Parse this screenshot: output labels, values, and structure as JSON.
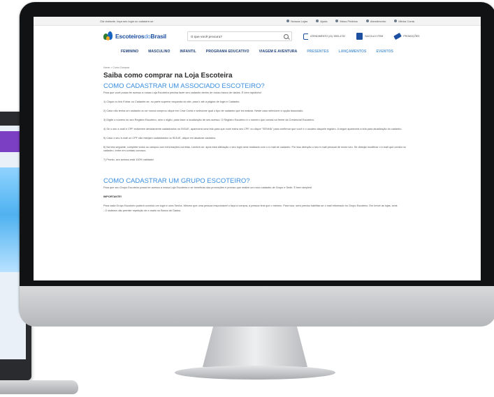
{
  "site": {
    "topbar": {
      "greeting": "Olá visitante, faça seu login ou cadastre-se",
      "links": [
        "Nossas Lojas",
        "Ajuda",
        "Meus Pedidos",
        "Atendimento",
        "Minha Conta"
      ]
    },
    "logo": {
      "part1": "Escoteiros",
      "part2": "do",
      "part3": "Brasil"
    },
    "search": {
      "placeholder": "O que você procura?"
    },
    "header_items": {
      "phone": "ATENDIMENTO (41) 3353-4732",
      "bag": "SACOLA 0 ITEM",
      "promo": "PROMOÇÕES"
    },
    "nav": [
      "FEMININO",
      "MASCULINO",
      "INFANTIL",
      "PROGRAMA EDUCATIVO",
      "VIAGEM E AVENTURA",
      "PRESENTES",
      "LANÇAMENTOS",
      "EVENTOS"
    ],
    "breadcrumb": "Home > Como Comprar",
    "title": "Saiba como comprar na Loja Escoteira",
    "section1": {
      "heading": "COMO CADASTRAR UM ASSOCIADO ESCOTEIRO?",
      "intro": "Para que você possa ter acesso a nossa Loja Escoteira precisa fazer seu cadastro dentro de nosso banco de dados. É bem rapidinho!",
      "steps": [
        "1) Clique no link Entrar ou Cadastre-se, no parte superior esquerda do site, para ir até a página de login e Cadastro.",
        "2) Caso não tenha um cadastro ou se nunca comprou clique em Criar Conta e selecione qual o tipo de cadastro que irá realizar. Neste caso selecione a opção Associado.",
        "3) Digite o número do seu Registro Escoteiro, sem o dígito, para fazer a localização de seu acesso. O Registro Escoteiro é o número que consta na frente da Credencial Escoteira.",
        "4) Se o seu e-mail e CPF estiverem devidamente cadastrados no SIGUE, aparecerá uma tela para que você insira seu CPF, ou clique \"SENHA\" para confirmar que você é o usuário daquele registro. A seguir aparecerá a tela para atualização do cadastro.",
        "5) Caso o seu e-mail ou CPF não estejam cadastrados no SIGUE, clique em atualizar cadastro.",
        "6) Na tela seguinte, complete todos os campos com informações corretas. Lembre-se, após esta alteração o seu login será realizado com o e-mail de cadastro. Por isso atenção o seu e-mail pessoal de modo seu. Se desejar modificar o e-mail que consta no cadastro, entre em contato conosco.",
        "7) Pronto, seu acesso está 100% validado!"
      ]
    },
    "section2": {
      "heading": "COMO CADASTRAR UM GRUPO ESCOTEIRO?",
      "intro": "Para que seu Grupo Escoteiro possa ter acesso a nossa Loja Escoteira e se beneficiar das promoções é preciso que realize um novo cadastro de Grupo e Sede. É bem simples!",
      "important_label": "IMPORTANTE!",
      "note": "Para cada Grupo Escoteiro poderá ocorrido um login e uma Senha. Mesmo que uma pessoa responsável o faça a compra, a pessoa terá que o mesmo. Para isso, será preciso habilitar-se o mail informado no Grupo Escoteiro. Em breve as lojas, será:",
      "note2": "- O sistema não permite repetição de e-mails no Banco de Dados."
    }
  }
}
